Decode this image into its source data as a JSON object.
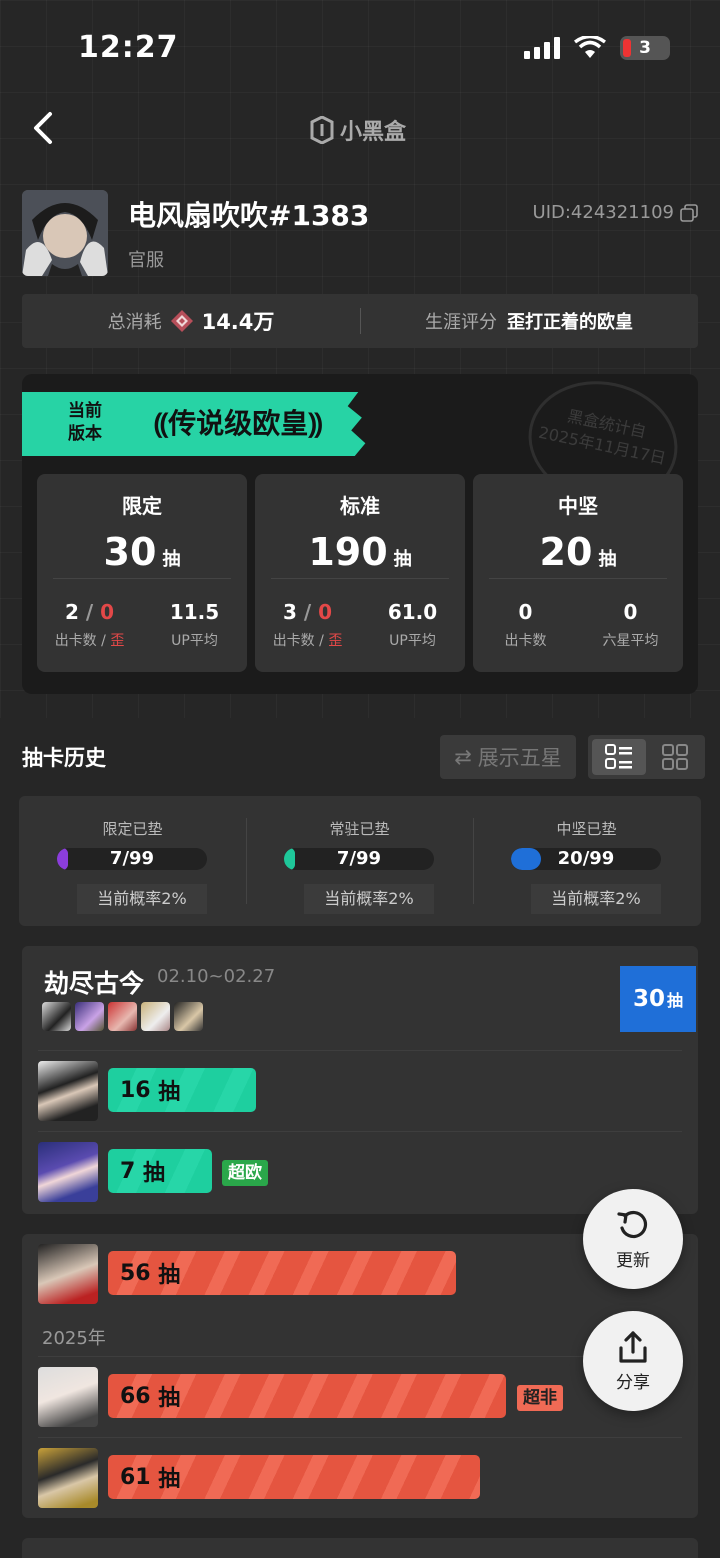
{
  "status": {
    "time": "12:27",
    "battery": "3"
  },
  "nav": {
    "app_name": "小黑盒"
  },
  "profile": {
    "name": "电风扇吹吹#1383",
    "server": "官服",
    "uid": "UID:424321109"
  },
  "summary": {
    "total_label": "总消耗",
    "total_value": "14.4万",
    "rating_label": "生涯评分",
    "rating_value": "歪打正着的欧皇"
  },
  "version": {
    "label_line1": "当前",
    "label_line2": "版本",
    "title": "传说级欧皇",
    "stamp_line1": "黑盒统计自",
    "stamp_line2": "2025年11月17日"
  },
  "stats": [
    {
      "title": "限定",
      "count": "30",
      "unit": "抽",
      "c1": "2",
      "c1_sep": "/",
      "c1_red": "0",
      "c2": "11.5",
      "s1": "出卡数 /",
      "s1_red": "歪",
      "s2": "UP平均"
    },
    {
      "title": "标准",
      "count": "190",
      "unit": "抽",
      "c1": "3",
      "c1_sep": "/",
      "c1_red": "0",
      "c2": "61.0",
      "s1": "出卡数 /",
      "s1_red": "歪",
      "s2": "UP平均"
    },
    {
      "title": "中坚",
      "count": "20",
      "unit": "抽",
      "c1": "0",
      "c1_sep": "",
      "c1_red": "",
      "c2": "0",
      "s1": "出卡数",
      "s1_red": "",
      "s2": "六星平均"
    }
  ],
  "history": {
    "title": "抽卡历史",
    "toggle_label": "展示五星"
  },
  "pity": [
    {
      "label": "限定已垫",
      "value": "7/99",
      "rate": "当前概率2%",
      "fraction": 0.0707,
      "color": "#8b3ddb"
    },
    {
      "label": "常驻已垫",
      "value": "7/99",
      "rate": "当前概率2%",
      "fraction": 0.0707,
      "color": "#1fc79a"
    },
    {
      "label": "中坚已垫",
      "value": "20/99",
      "rate": "当前概率2%",
      "fraction": 0.202,
      "color": "#1f6fd8"
    }
  ],
  "pool1": {
    "name": "劫尽古今",
    "dates": "02.10~02.27",
    "badge_count": "30",
    "badge_unit": "抽",
    "rows": [
      {
        "pulls": "16",
        "unit": "抽",
        "tag": ""
      },
      {
        "pulls": "7",
        "unit": "抽",
        "tag": "超欧"
      }
    ]
  },
  "pool2": {
    "year": "2025年",
    "rows": [
      {
        "pulls": "56",
        "unit": "抽",
        "tag": ""
      },
      {
        "pulls": "66",
        "unit": "抽",
        "tag": "超非"
      },
      {
        "pulls": "61",
        "unit": "抽",
        "tag": ""
      }
    ]
  },
  "fab": {
    "refresh": "更新",
    "share": "分享"
  },
  "colors": {
    "accent_green": "#27d3a5",
    "accent_red": "#f06a55",
    "accent_blue": "#1f6fd8"
  }
}
